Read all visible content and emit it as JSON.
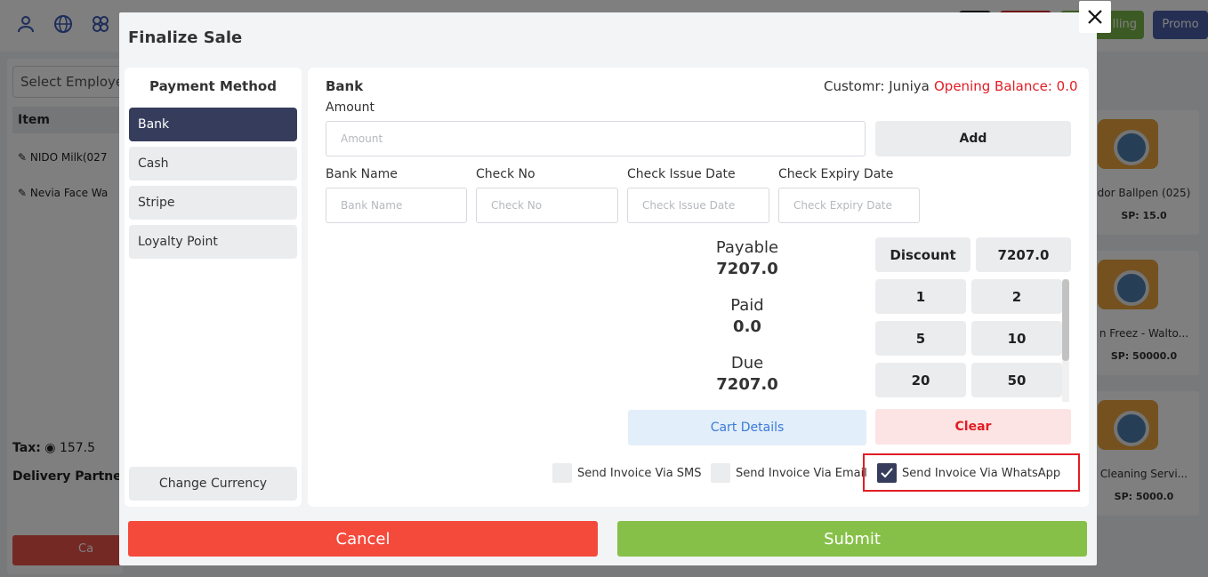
{
  "background": {
    "employee_select_placeholder": "Select Employee",
    "table_header_item": "Item",
    "rows": [
      "NIDO Milk(027",
      "Nevia Face Wa"
    ],
    "tax_label": "Tax:",
    "tax_value": "157.5",
    "delivery_partner_label": "Delivery Partner:",
    "cancel_label": "Ca",
    "top_buttons": [
      "lling",
      "Promo"
    ],
    "products": [
      {
        "name": "dor Ballpen (025)",
        "price": "SP: 15.0"
      },
      {
        "name": "n Freez - Walto...",
        "price": "SP: 50000.0"
      },
      {
        "name": "Cleaning Servi...",
        "price": "SP: 5000.0"
      }
    ]
  },
  "modal": {
    "title": "Finalize Sale",
    "close_label": "✕"
  },
  "payment_methods": {
    "heading": "Payment Method",
    "items": [
      {
        "label": "Bank",
        "active": true
      },
      {
        "label": "Cash",
        "active": false
      },
      {
        "label": "Stripe",
        "active": false
      },
      {
        "label": "Loyalty Point",
        "active": false
      }
    ],
    "change_currency_label": "Change Currency"
  },
  "main": {
    "method_title": "Bank",
    "customer_text": "Customr: Juniya",
    "opening_balance_text": "Opening Balance: 0.0",
    "amount_label": "Amount",
    "amount_placeholder": "Amount",
    "add_label": "Add",
    "bank_name_label": "Bank Name",
    "bank_name_placeholder": "Bank Name",
    "check_no_label": "Check No",
    "check_no_placeholder": "Check No",
    "check_issue_label": "Check Issue Date",
    "check_issue_placeholder": "Check Issue Date",
    "check_expiry_label": "Check Expiry Date",
    "check_expiry_placeholder": "Check Expiry Date"
  },
  "summary": {
    "payable_label": "Payable",
    "payable_value": "7207.0",
    "paid_label": "Paid",
    "paid_value": "0.0",
    "due_label": "Due",
    "due_value": "7207.0"
  },
  "keypad": {
    "discount_label": "Discount",
    "discount_value": "7207.0",
    "keys": [
      "1",
      "2",
      "5",
      "10",
      "20",
      "50"
    ]
  },
  "actions": {
    "cart_details_label": "Cart Details",
    "clear_label": "Clear",
    "cancel_label": "Cancel",
    "submit_label": "Submit"
  },
  "invoice_options": {
    "sms_label": "Send Invoice Via SMS",
    "sms_checked": false,
    "email_label": "Send Invoice Via Email",
    "email_checked": false,
    "whatsapp_label": "Send Invoice Via WhatsApp",
    "whatsapp_checked": true
  },
  "colors": {
    "active_method": "#363d5c",
    "cancel": "#f44a3c",
    "submit": "#87c049",
    "danger_text": "#e11d24",
    "link_blue": "#3a7bd5"
  }
}
